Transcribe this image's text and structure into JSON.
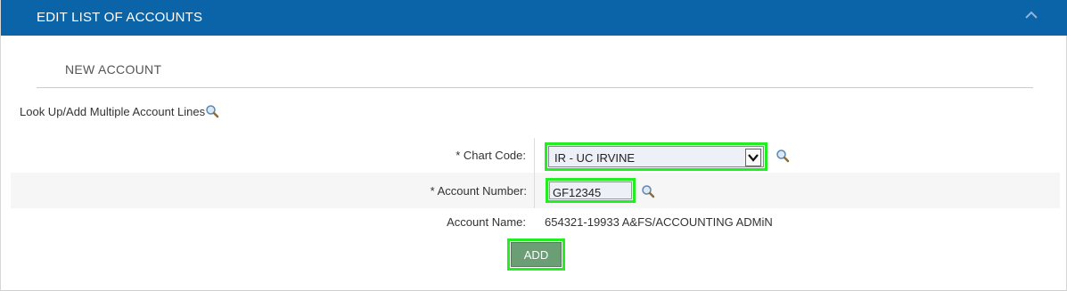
{
  "header": {
    "title": "EDIT LIST OF ACCOUNTS",
    "collapse_icon": "chevron-up-icon"
  },
  "section": {
    "title": "NEW ACCOUNT"
  },
  "lookup": {
    "label": "Look Up/Add Multiple Account Lines",
    "icon": "magnifier-icon"
  },
  "form": {
    "chart_code": {
      "label": "* Chart Code:",
      "value": "IR - UC IRVINE"
    },
    "account_number": {
      "label": "* Account Number:",
      "value": "GF12345"
    },
    "account_name": {
      "label": "Account Name:",
      "value": "654321-19933 A&FS/ACCOUNTING ADMiN"
    },
    "add_button": "ADD"
  },
  "colors": {
    "header_bg": "#0b63a8",
    "highlight": "#22ee22",
    "button_bg": "#6c9e75"
  }
}
